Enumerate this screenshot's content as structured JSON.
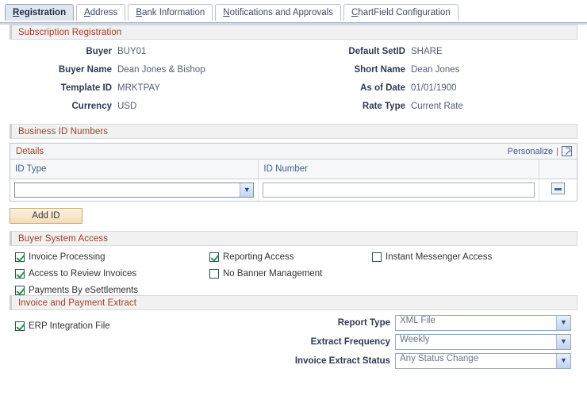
{
  "tabs": [
    {
      "label": "Registration",
      "accel": "R",
      "active": true
    },
    {
      "label": "Address",
      "accel": "A",
      "active": false
    },
    {
      "label": "Bank Information",
      "accel": "B",
      "active": false
    },
    {
      "label": "Notifications and Approvals",
      "accel": "N",
      "active": false
    },
    {
      "label": "ChartField Configuration",
      "accel": "C",
      "active": false
    }
  ],
  "subscription": {
    "title": "Subscription Registration",
    "left": [
      {
        "label": "Buyer",
        "value": "BUY01"
      },
      {
        "label": "Buyer Name",
        "value": "Dean Jones & Bishop"
      },
      {
        "label": "Template ID",
        "value": "MRKTPAY"
      },
      {
        "label": "Currency",
        "value": "USD"
      }
    ],
    "right": [
      {
        "label": "Default SetID",
        "value": "SHARE"
      },
      {
        "label": "Short Name",
        "value": "Dean Jones"
      },
      {
        "label": "As of Date",
        "value": "01/01/1900"
      },
      {
        "label": "Rate Type",
        "value": "Current Rate"
      }
    ]
  },
  "business_ids": {
    "title": "Business ID Numbers",
    "grid_title": "Details",
    "personalize_label": "Personalize",
    "separator": "|",
    "expand_icon": "expand-grid-icon",
    "columns": [
      "ID Type",
      "ID Number"
    ],
    "rows": [
      {
        "id_type": "",
        "id_number": "",
        "delete_label": "delete-row"
      }
    ],
    "add_button": "Add ID"
  },
  "buyer_access": {
    "title": "Buyer System Access",
    "items": [
      {
        "label": "Invoice Processing",
        "checked": true,
        "col": 1,
        "row": 1
      },
      {
        "label": "Access to Review Invoices",
        "checked": true,
        "col": 1,
        "row": 2
      },
      {
        "label": "Payments By eSettlements",
        "checked": true,
        "col": 1,
        "row": 3
      },
      {
        "label": "Reporting Access",
        "checked": true,
        "col": 2,
        "row": 1
      },
      {
        "label": "No Banner Management",
        "checked": false,
        "col": 2,
        "row": 2
      },
      {
        "label": "Instant Messenger Access",
        "checked": false,
        "col": 3,
        "row": 1
      }
    ]
  },
  "extract": {
    "title": "Invoice and Payment Extract",
    "erp_checkbox": {
      "label": "ERP Integration File",
      "checked": true
    },
    "fields": [
      {
        "label": "Report Type",
        "value": "XML File"
      },
      {
        "label": "Extract Frequency",
        "value": "Weekly"
      },
      {
        "label": "Invoice Extract Status",
        "value": "Any Status Change"
      }
    ]
  },
  "colors": {
    "section_header_text": "#a63d25",
    "label_text": "#2d3a54",
    "value_text": "#555f73",
    "link": "#3f5a96",
    "check_green": "#1d9a3c",
    "add_button_bg": "#f3dcb8"
  }
}
